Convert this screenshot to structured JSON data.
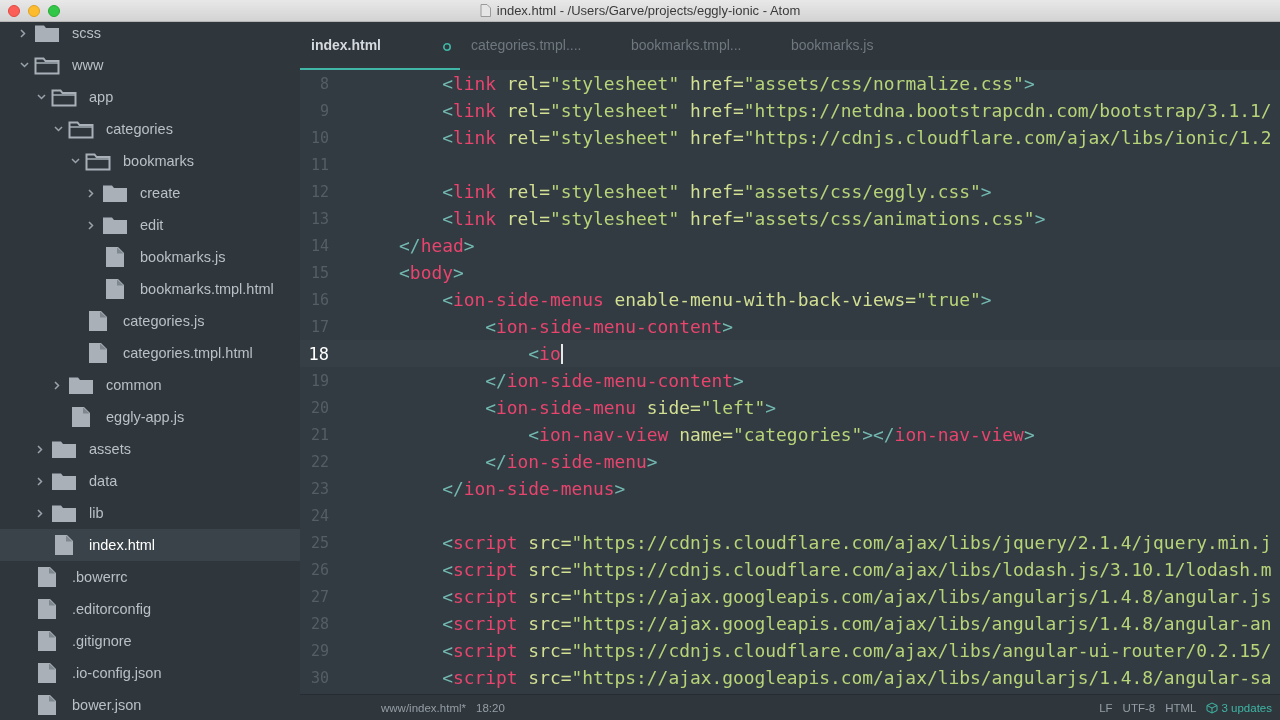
{
  "window": {
    "title": "index.html - /Users/Garve/projects/eggly-ionic - Atom"
  },
  "sidebar": {
    "tree": [
      {
        "name": "scss",
        "kind": "folder",
        "expanded": false,
        "selected": false
      },
      {
        "name": "www",
        "kind": "folder",
        "expanded": true,
        "selected": false,
        "children": [
          {
            "name": "app",
            "kind": "folder",
            "expanded": true,
            "selected": false,
            "children": [
              {
                "name": "categories",
                "kind": "folder",
                "expanded": true,
                "selected": false,
                "children": [
                  {
                    "name": "bookmarks",
                    "kind": "folder",
                    "expanded": true,
                    "selected": false,
                    "children": [
                      {
                        "name": "create",
                        "kind": "folder",
                        "expanded": false,
                        "selected": false
                      },
                      {
                        "name": "edit",
                        "kind": "folder",
                        "expanded": false,
                        "selected": false
                      },
                      {
                        "name": "bookmarks.js",
                        "kind": "file",
                        "selected": false
                      },
                      {
                        "name": "bookmarks.tmpl.html",
                        "kind": "file",
                        "selected": false
                      }
                    ]
                  },
                  {
                    "name": "categories.js",
                    "kind": "file",
                    "selected": false
                  },
                  {
                    "name": "categories.tmpl.html",
                    "kind": "file",
                    "selected": false
                  }
                ]
              },
              {
                "name": "common",
                "kind": "folder",
                "expanded": false,
                "selected": false
              },
              {
                "name": "eggly-app.js",
                "kind": "file",
                "selected": false
              }
            ]
          },
          {
            "name": "assets",
            "kind": "folder",
            "expanded": false,
            "selected": false
          },
          {
            "name": "data",
            "kind": "folder",
            "expanded": false,
            "selected": false
          },
          {
            "name": "lib",
            "kind": "folder",
            "expanded": false,
            "selected": false
          },
          {
            "name": "index.html",
            "kind": "file",
            "selected": true
          }
        ]
      },
      {
        "name": ".bowerrc",
        "kind": "file",
        "selected": false
      },
      {
        "name": ".editorconfig",
        "kind": "file",
        "selected": false
      },
      {
        "name": ".gitignore",
        "kind": "file",
        "selected": false
      },
      {
        "name": ".io-config.json",
        "kind": "file",
        "selected": false
      },
      {
        "name": "bower.json",
        "kind": "file",
        "selected": false
      }
    ]
  },
  "tabs": [
    {
      "label": "index.html",
      "selected": true,
      "modified": true
    },
    {
      "label": "categories.tmpl....",
      "selected": false,
      "modified": false
    },
    {
      "label": "bookmarks.tmpl...",
      "selected": false,
      "modified": false
    },
    {
      "label": "bookmarks.js",
      "selected": false,
      "modified": false
    }
  ],
  "editor": {
    "lines": [
      {
        "number": "8",
        "current": false,
        "tokens": [
          {
            "kind": "punctuation",
            "text": "        <"
          },
          {
            "kind": "tag",
            "text": "link"
          },
          {
            "kind": "attribute",
            "text": " rel="
          },
          {
            "kind": "string",
            "text": "\"stylesheet\""
          },
          {
            "kind": "attribute",
            "text": " href="
          },
          {
            "kind": "string",
            "text": "\"assets/css/normalize.css\""
          },
          {
            "kind": "punctuation",
            "text": ">"
          }
        ]
      },
      {
        "number": "9",
        "current": false,
        "tokens": [
          {
            "kind": "punctuation",
            "text": "        <"
          },
          {
            "kind": "tag",
            "text": "link"
          },
          {
            "kind": "attribute",
            "text": " rel="
          },
          {
            "kind": "string",
            "text": "\"stylesheet\""
          },
          {
            "kind": "attribute",
            "text": " href="
          },
          {
            "kind": "string",
            "text": "\"https://netdna.bootstrapcdn.com/bootstrap/3.1.1/"
          }
        ]
      },
      {
        "number": "10",
        "current": false,
        "tokens": [
          {
            "kind": "punctuation",
            "text": "        <"
          },
          {
            "kind": "tag",
            "text": "link"
          },
          {
            "kind": "attribute",
            "text": " rel="
          },
          {
            "kind": "string",
            "text": "\"stylesheet\""
          },
          {
            "kind": "attribute",
            "text": " href="
          },
          {
            "kind": "string",
            "text": "\"https://cdnjs.cloudflare.com/ajax/libs/ionic/1.2"
          }
        ]
      },
      {
        "number": "11",
        "current": false
      },
      {
        "number": "12",
        "current": false,
        "tokens": [
          {
            "kind": "punctuation",
            "text": "        <"
          },
          {
            "kind": "tag",
            "text": "link"
          },
          {
            "kind": "attribute",
            "text": " rel="
          },
          {
            "kind": "string",
            "text": "\"stylesheet\""
          },
          {
            "kind": "attribute",
            "text": " href="
          },
          {
            "kind": "string",
            "text": "\"assets/css/eggly.css\""
          },
          {
            "kind": "punctuation",
            "text": ">"
          }
        ]
      },
      {
        "number": "13",
        "current": false,
        "tokens": [
          {
            "kind": "punctuation",
            "text": "        <"
          },
          {
            "kind": "tag",
            "text": "link"
          },
          {
            "kind": "attribute",
            "text": " rel="
          },
          {
            "kind": "string",
            "text": "\"stylesheet\""
          },
          {
            "kind": "attribute",
            "text": " href="
          },
          {
            "kind": "string",
            "text": "\"assets/css/animations.css\""
          },
          {
            "kind": "punctuation",
            "text": ">"
          }
        ]
      },
      {
        "number": "14",
        "current": false,
        "tokens": [
          {
            "kind": "punctuation",
            "text": "    </"
          },
          {
            "kind": "tag",
            "text": "head"
          },
          {
            "kind": "punctuation",
            "text": ">"
          }
        ]
      },
      {
        "number": "15",
        "current": false,
        "tokens": [
          {
            "kind": "punctuation",
            "text": "    <"
          },
          {
            "kind": "tag",
            "text": "body"
          },
          {
            "kind": "punctuation",
            "text": ">"
          }
        ]
      },
      {
        "number": "16",
        "current": false,
        "tokens": [
          {
            "kind": "punctuation",
            "text": "        <"
          },
          {
            "kind": "tag",
            "text": "ion-side-menus"
          },
          {
            "kind": "attribute",
            "text": " enable-menu-with-back-views="
          },
          {
            "kind": "string",
            "text": "\"true\""
          },
          {
            "kind": "punctuation",
            "text": ">"
          }
        ]
      },
      {
        "number": "17",
        "current": false,
        "tokens": [
          {
            "kind": "punctuation",
            "text": "            <"
          },
          {
            "kind": "tag",
            "text": "ion-side-menu-content"
          },
          {
            "kind": "punctuation",
            "text": ">"
          }
        ]
      },
      {
        "number": "18",
        "current": true,
        "tokens": [
          {
            "kind": "punctuation",
            "text": "                <"
          },
          {
            "kind": "tag",
            "text": "io"
          }
        ]
      },
      {
        "number": "19",
        "current": false,
        "tokens": [
          {
            "kind": "punctuation",
            "text": "            </"
          },
          {
            "kind": "tag",
            "text": "ion-side-menu-content"
          },
          {
            "kind": "punctuation",
            "text": ">"
          }
        ]
      },
      {
        "number": "20",
        "current": false,
        "tokens": [
          {
            "kind": "punctuation",
            "text": "            <"
          },
          {
            "kind": "tag",
            "text": "ion-side-menu"
          },
          {
            "kind": "attribute",
            "text": " side="
          },
          {
            "kind": "string",
            "text": "\"left\""
          },
          {
            "kind": "punctuation",
            "text": ">"
          }
        ]
      },
      {
        "number": "21",
        "current": false,
        "tokens": [
          {
            "kind": "punctuation",
            "text": "                <"
          },
          {
            "kind": "tag",
            "text": "ion-nav-view"
          },
          {
            "kind": "attribute",
            "text": " name="
          },
          {
            "kind": "string",
            "text": "\"categories\""
          },
          {
            "kind": "punctuation",
            "text": "></"
          },
          {
            "kind": "tag",
            "text": "ion-nav-view"
          },
          {
            "kind": "punctuation",
            "text": ">"
          }
        ]
      },
      {
        "number": "22",
        "current": false,
        "tokens": [
          {
            "kind": "punctuation",
            "text": "            </"
          },
          {
            "kind": "tag",
            "text": "ion-side-menu"
          },
          {
            "kind": "punctuation",
            "text": ">"
          }
        ]
      },
      {
        "number": "23",
        "current": false,
        "tokens": [
          {
            "kind": "punctuation",
            "text": "        </"
          },
          {
            "kind": "tag",
            "text": "ion-side-menus"
          },
          {
            "kind": "punctuation",
            "text": ">"
          }
        ]
      },
      {
        "number": "24",
        "current": false
      },
      {
        "number": "25",
        "current": false,
        "tokens": [
          {
            "kind": "punctuation",
            "text": "        <"
          },
          {
            "kind": "tag",
            "text": "script"
          },
          {
            "kind": "attribute",
            "text": " src="
          },
          {
            "kind": "string",
            "text": "\"https://cdnjs.cloudflare.com/ajax/libs/jquery/2.1.4/jquery.min.j"
          }
        ]
      },
      {
        "number": "26",
        "current": false,
        "tokens": [
          {
            "kind": "punctuation",
            "text": "        <"
          },
          {
            "kind": "tag",
            "text": "script"
          },
          {
            "kind": "attribute",
            "text": " src="
          },
          {
            "kind": "string",
            "text": "\"https://cdnjs.cloudflare.com/ajax/libs/lodash.js/3.10.1/lodash.m"
          }
        ]
      },
      {
        "number": "27",
        "current": false,
        "tokens": [
          {
            "kind": "punctuation",
            "text": "        <"
          },
          {
            "kind": "tag",
            "text": "script"
          },
          {
            "kind": "attribute",
            "text": " src="
          },
          {
            "kind": "string",
            "text": "\"https://ajax.googleapis.com/ajax/libs/angularjs/1.4.8/angular.js"
          }
        ]
      },
      {
        "number": "28",
        "current": false,
        "tokens": [
          {
            "kind": "punctuation",
            "text": "        <"
          },
          {
            "kind": "tag",
            "text": "script"
          },
          {
            "kind": "attribute",
            "text": " src="
          },
          {
            "kind": "string",
            "text": "\"https://ajax.googleapis.com/ajax/libs/angularjs/1.4.8/angular-an"
          }
        ]
      },
      {
        "number": "29",
        "current": false,
        "tokens": [
          {
            "kind": "punctuation",
            "text": "        <"
          },
          {
            "kind": "tag",
            "text": "script"
          },
          {
            "kind": "attribute",
            "text": " src="
          },
          {
            "kind": "string",
            "text": "\"https://cdnjs.cloudflare.com/ajax/libs/angular-ui-router/0.2.15/"
          }
        ]
      },
      {
        "number": "30",
        "current": false,
        "tokens": [
          {
            "kind": "punctuation",
            "text": "        <"
          },
          {
            "kind": "tag",
            "text": "script"
          },
          {
            "kind": "attribute",
            "text": " src="
          },
          {
            "kind": "string",
            "text": "\"https://ajax.googleapis.com/ajax/libs/angularjs/1.4.8/angular-sa"
          }
        ]
      }
    ]
  },
  "status_bar": {
    "file": "www/index.html*",
    "position": "18:20",
    "line_ending": "LF",
    "encoding": "UTF-8",
    "grammar": "HTML",
    "updates": "3 updates"
  }
}
